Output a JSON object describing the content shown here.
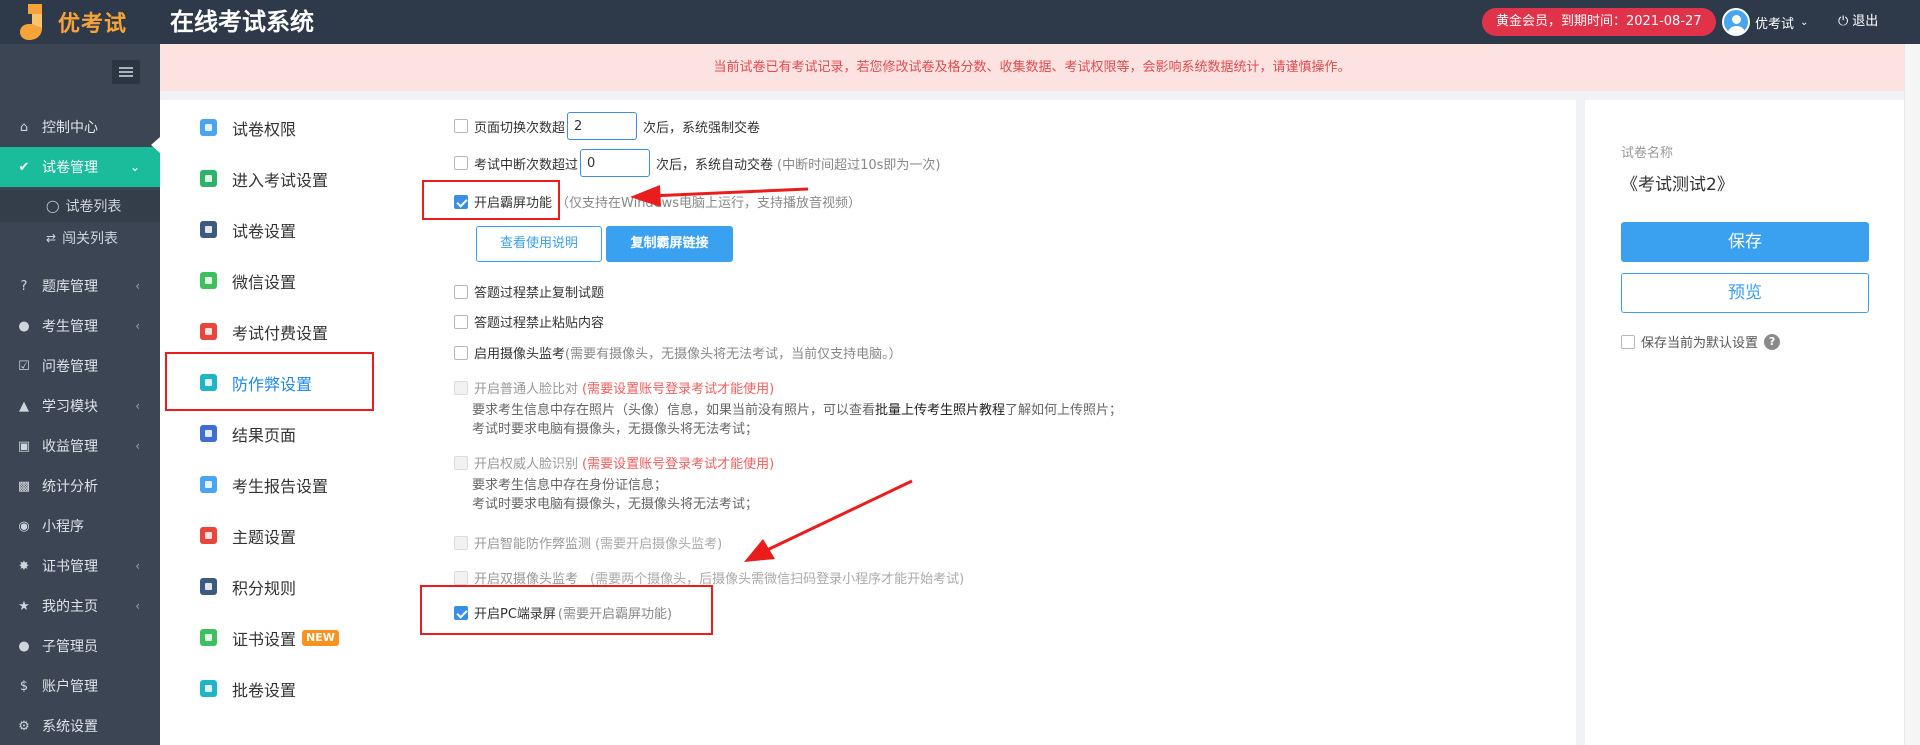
{
  "header": {
    "logo_text": "优考试",
    "system_title": "在线考试系统",
    "vip_badge": "黄金会员，到期时间：2021-08-27",
    "user_name": "优考试",
    "logout": "退出"
  },
  "sidebar": {
    "items": [
      {
        "label": "控制中心",
        "icon": "home-icon"
      },
      {
        "label": "试卷管理",
        "icon": "check-circle-icon"
      },
      {
        "label": "题库管理",
        "icon": "question-icon"
      },
      {
        "label": "考生管理",
        "icon": "user-icon"
      },
      {
        "label": "问卷管理",
        "icon": "checkbox-icon"
      },
      {
        "label": "学习模块",
        "icon": "graduation-icon"
      },
      {
        "label": "收益管理",
        "icon": "money-icon"
      },
      {
        "label": "统计分析",
        "icon": "bar-chart-icon"
      },
      {
        "label": "小程序",
        "icon": "wechat-icon"
      },
      {
        "label": "证书管理",
        "icon": "certificate-icon"
      },
      {
        "label": "我的主页",
        "icon": "homepage-icon"
      },
      {
        "label": "子管理员",
        "icon": "sub-admin-icon"
      },
      {
        "label": "账户管理",
        "icon": "dollar-icon"
      },
      {
        "label": "系统设置",
        "icon": "gear-icon"
      }
    ],
    "sub_items": [
      {
        "label": "试卷列表"
      },
      {
        "label": "闯关列表"
      }
    ]
  },
  "warning": "当前试卷已有考试记录，若您修改试卷及格分数、收集数据、考试权限等，会影响系统数据统计，请谨慎操作。",
  "menu": {
    "items": [
      {
        "label": "试卷权限",
        "color": "#4aa5f0"
      },
      {
        "label": "进入考试设置",
        "color": "#2fb36b"
      },
      {
        "label": "试卷设置",
        "color": "#3c5a80"
      },
      {
        "label": "微信设置",
        "color": "#3fbf5e"
      },
      {
        "label": "考试付费设置",
        "color": "#e8453c"
      },
      {
        "label": "防作弊设置",
        "color": "#1fb5c4"
      },
      {
        "label": "结果页面",
        "color": "#3e6fd0"
      },
      {
        "label": "考生报告设置",
        "color": "#4aa5f0"
      },
      {
        "label": "主题设置",
        "color": "#e8453c"
      },
      {
        "label": "积分规则",
        "color": "#3c5a80"
      },
      {
        "label": "证书设置",
        "color": "#3fbf5e"
      },
      {
        "label": "批卷设置",
        "color": "#1fb5c4"
      }
    ],
    "new_badge": "NEW"
  },
  "settings": {
    "page_switch": {
      "label": "页面切换次数超",
      "value": "2",
      "suffix": "次后，系统强制交卷"
    },
    "interrupt": {
      "label": "考试中断次数超过",
      "value": "0",
      "suffix": "次后，系统自动交卷",
      "hint": "(中断时间超过10s即为一次)"
    },
    "lockscreen": {
      "label": "开启霸屏功能",
      "hint": "（仅支持在Windows电脑上运行，支持播放音视频）"
    },
    "btn_usage": "查看使用说明",
    "btn_copy_link": "复制霸屏链接",
    "no_copy": {
      "label": "答题过程禁止复制试题"
    },
    "no_paste": {
      "label": "答题过程禁止粘贴内容"
    },
    "camera": {
      "label": "启用摄像头监考",
      "hint": "(需要有摄像头，无摄像头将无法考试，当前仅支持电脑。）"
    },
    "face_compare": {
      "label": "开启普通人脸比对",
      "hint": "(需要设置账号登录考试才能使用)"
    },
    "face_compare_note1_pre": "要求考生信息中存在照片（头像）信息，如果当前没有照片，可以查看",
    "face_compare_note1_link": "批量上传考生照片教程",
    "face_compare_note1_post": "了解如何上传照片；",
    "face_compare_note2": "考试时要求电脑有摄像头，无摄像头将无法考试；",
    "auth_face": {
      "label": "开启权威人脸识别",
      "hint": "(需要设置账号登录考试才能使用)"
    },
    "auth_face_note1": "要求考生信息中存在身份证信息；",
    "auth_face_note2": "考试时要求电脑有摄像头，无摄像头将无法考试；",
    "smart_cheat": {
      "label": "开启智能防作弊监测",
      "hint": "(需要开启摄像头监考)"
    },
    "dual_camera": {
      "label": "开启双摄像头监考",
      "hint": "(需要两个摄像头，后摄像头需微信扫码登录小程序才能开始考试)"
    },
    "pc_record": {
      "label": "开启PC端录屏",
      "hint": "(需要开启霸屏功能)"
    }
  },
  "right_panel": {
    "paper_label": "试卷名称",
    "paper_name": "《考试测试2》",
    "save": "保存",
    "preview": "预览",
    "save_default": "保存当前为默认设置"
  },
  "colors": {
    "topbar": "#2e3a49",
    "sidebar": "#3b4553",
    "sidebar_active": "#1abc9c",
    "accent": "#3aa0f0",
    "annotation": "#ea1c1c",
    "vip": "#e0334a"
  }
}
